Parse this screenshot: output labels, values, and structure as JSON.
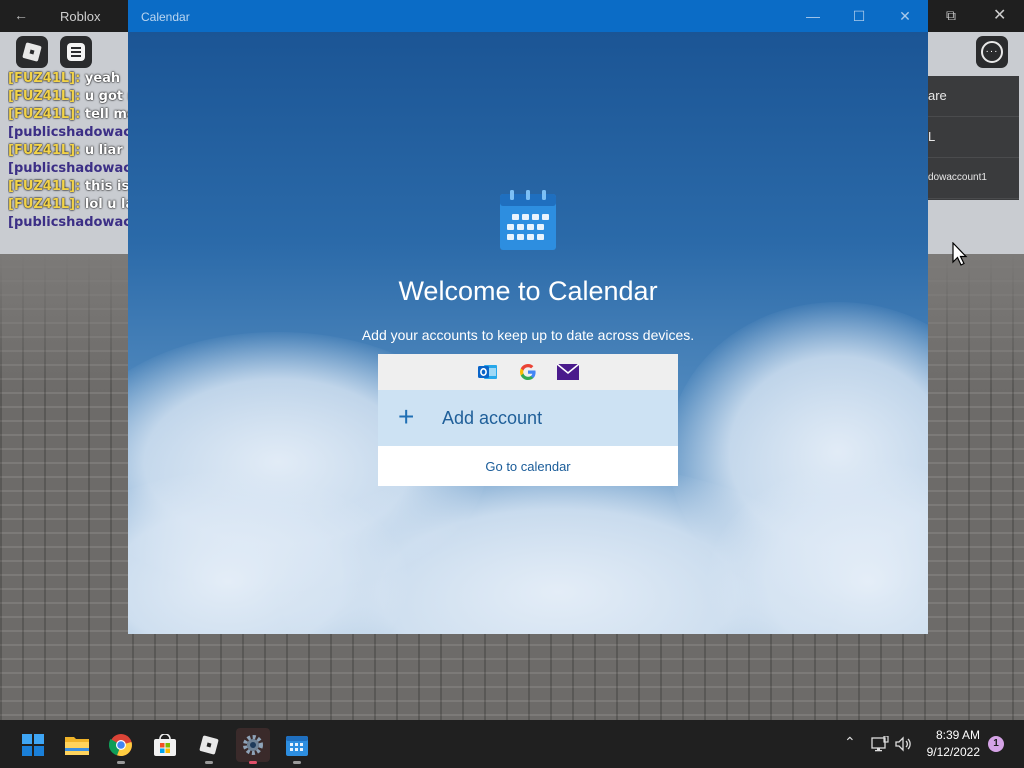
{
  "roblox": {
    "window_title": "Roblox",
    "chat": [
      {
        "name": "",
        "msg": "",
        "color": "purple"
      },
      {
        "name": "[FUZ41L]:",
        "msg": "yeah",
        "color": "yellow"
      },
      {
        "name": "[FUZ41L]:",
        "msg": "u got ro",
        "color": "yellow"
      },
      {
        "name": "[FUZ41L]:",
        "msg": "tell me r",
        "color": "yellow"
      },
      {
        "name": "[publicshadowacc",
        "msg": "",
        "color": "purple"
      },
      {
        "name": "[FUZ41L]:",
        "msg": "u liar",
        "color": "yellow"
      },
      {
        "name": "[publicshadowacc",
        "msg": "",
        "color": "purple"
      },
      {
        "name": "[FUZ41L]:",
        "msg": "this is p",
        "color": "yellow"
      },
      {
        "name": "[FUZ41L]:",
        "msg": "lol u lag",
        "color": "yellow"
      },
      {
        "name": "[publicshadowacc",
        "msg": "",
        "color": "purple"
      }
    ],
    "player_list": [
      "are",
      "L",
      "dowaccount1"
    ]
  },
  "calendar": {
    "window_title": "Calendar",
    "welcome": "Welcome to Calendar",
    "subtitle": "Add your accounts to keep up to date across devices.",
    "providers": [
      "outlook-icon",
      "google-icon",
      "mail-icon"
    ],
    "add_account_label": "Add account",
    "go_to_calendar_label": "Go to calendar"
  },
  "taskbar": {
    "apps": [
      "start-icon",
      "file-explorer-icon",
      "chrome-icon",
      "microsoft-store-icon",
      "roblox-icon",
      "settings-icon",
      "calendar-icon"
    ],
    "time": "8:39 AM",
    "date": "9/12/2022",
    "notification_count": "1"
  }
}
